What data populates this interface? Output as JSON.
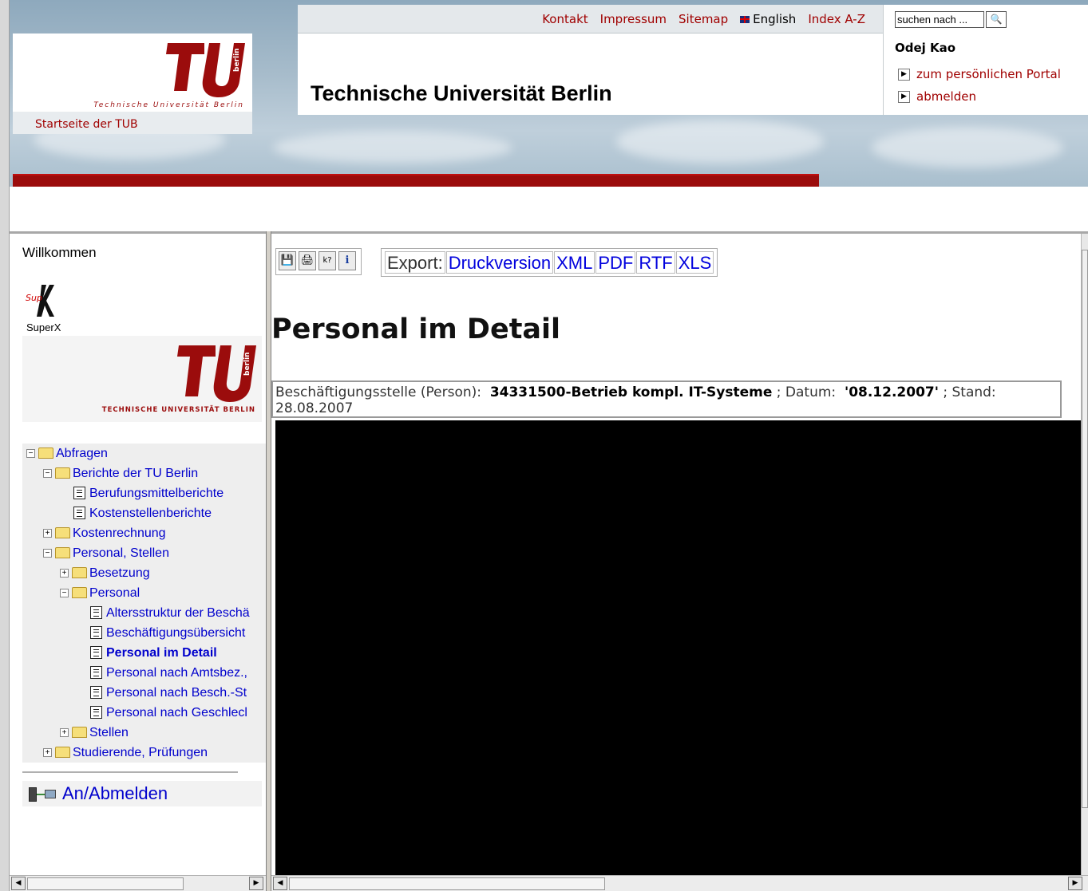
{
  "topnav": {
    "kontakt": "Kontakt",
    "impressum": "Impressum",
    "sitemap": "Sitemap",
    "english": "English",
    "index": "Index A-Z"
  },
  "search": {
    "placeholder": "suchen nach ...",
    "value": "suchen nach ...",
    "button_icon": "search-icon"
  },
  "user": {
    "name": "Odej Kao",
    "portal_link": "zum persönlichen Portal",
    "logout_link": "abmelden"
  },
  "header": {
    "logo_caption": "Technische Universität Berlin",
    "logo_mark": "berlin",
    "site_title": "Technische Universität Berlin",
    "home_link": "Startseite der TUB"
  },
  "sidebar": {
    "welcome": "Willkommen",
    "superx_label": "SuperX",
    "logo_caption": "TECHNISCHE UNIVERSITÄT BERLIN",
    "logo_mark": "berlin",
    "tree": [
      {
        "label": "Abfragen",
        "toggle": "⊟",
        "type": "folder-open"
      },
      {
        "label": "Berichte der TU Berlin",
        "toggle": "⊟",
        "type": "folder-open"
      },
      {
        "label": "Berufungsmittelberichte",
        "type": "doc"
      },
      {
        "label": "Kostenstellenberichte",
        "type": "doc"
      },
      {
        "label": "Kostenrechnung",
        "toggle": "⊞",
        "type": "folder"
      },
      {
        "label": "Personal, Stellen",
        "toggle": "⊟",
        "type": "folder-open"
      },
      {
        "label": "Besetzung",
        "toggle": "⊞",
        "type": "folder"
      },
      {
        "label": "Personal",
        "toggle": "⊟",
        "type": "folder-open"
      },
      {
        "label": "Altersstruktur der Beschä",
        "type": "doc"
      },
      {
        "label": "Beschäftigungsübersicht",
        "type": "doc"
      },
      {
        "label": "Personal im Detail",
        "type": "doc",
        "selected": true
      },
      {
        "label": "Personal nach Amtsbez.,",
        "type": "doc"
      },
      {
        "label": "Personal nach Besch.-St",
        "type": "doc"
      },
      {
        "label": "Personal nach Geschlecl",
        "type": "doc"
      },
      {
        "label": "Stellen",
        "toggle": "⊞",
        "type": "folder"
      },
      {
        "label": "Studierende, Prüfungen",
        "toggle": "⊞",
        "type": "folder"
      }
    ],
    "login_label": "An/Abmelden"
  },
  "toolbar": {
    "icons": [
      "save-icon",
      "print-icon",
      "help-cursor-icon",
      "info-icon"
    ],
    "info_glyph": "i",
    "help_glyph": "k?"
  },
  "export": {
    "label": "Export:",
    "druck": "Druckversion",
    "xml": "XML",
    "pdf": "PDF",
    "rtf": "RTF",
    "xls": "XLS"
  },
  "report": {
    "title": "Personal im Detail",
    "filter_label": "Beschäftigungsstelle (Person):",
    "filter_value": "34331500-Betrieb kompl. IT-Systeme",
    "date_label": "; Datum:",
    "date_value": "'08.12.2007'",
    "stand_label": "; Stand:",
    "stand_value": "28.08.2007"
  },
  "colors": {
    "brand_red": "#9b0c0c",
    "link_blue": "#0000cc",
    "header_link_red": "#a00000"
  }
}
